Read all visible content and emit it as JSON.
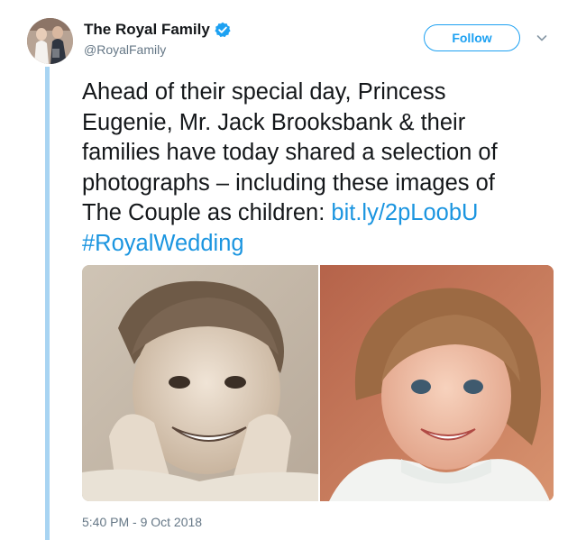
{
  "author": {
    "display_name": "The Royal Family",
    "handle": "@RoyalFamily",
    "verified": true
  },
  "actions": {
    "follow_label": "Follow",
    "menu_icon": "chevron-down-icon"
  },
  "tweet": {
    "lines": [
      "Ahead of their special day, Princess",
      "Eugenie, Mr. Jack Brooksbank & their",
      "families have today shared a selection of",
      "photographs – including these images of",
      "The Couple as children: "
    ],
    "link": "bit.ly/2pLoobU",
    "hashtag": "#RoyalWedding"
  },
  "media": {
    "photos": [
      {
        "icon": "boy-photo"
      },
      {
        "icon": "girl-photo"
      }
    ]
  },
  "timestamp": "5:40 PM - 9 Oct 2018",
  "colors": {
    "accent": "#1da1f2",
    "link": "#1b95e0",
    "text": "#14171a",
    "secondary": "#657786",
    "thread_line": "#a8d4f2"
  }
}
